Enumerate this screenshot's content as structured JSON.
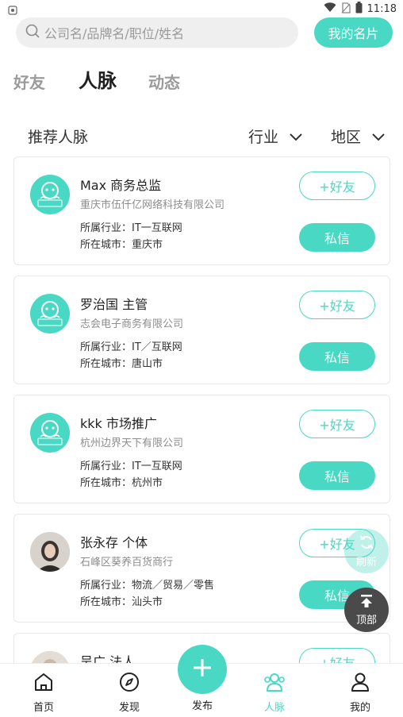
{
  "status": {
    "time": "11:18"
  },
  "search": {
    "placeholder": "公司名/品牌名/职位/姓名",
    "my_card_label": "我的名片"
  },
  "tabs": [
    {
      "label": "好友"
    },
    {
      "label": "人脉"
    },
    {
      "label": "动态"
    }
  ],
  "filters": {
    "title": "推荐人脉",
    "industry_label": "行业",
    "region_label": "地区"
  },
  "contacts": [
    {
      "name": "Max 商务总监",
      "company": "重庆市伍仟亿网络科技有限公司",
      "industry": "所属行业：IT一互联网",
      "city": "所在城市：重庆市",
      "add_label": "+好友",
      "msg_label": "私信",
      "avatar_text": "职场联盟"
    },
    {
      "name": "罗治国 主管",
      "company": "志会电子商务有限公司",
      "industry": "所属行业：IT／互联网",
      "city": "所在城市：唐山市",
      "add_label": "+好友",
      "msg_label": "私信",
      "avatar_text": "职场联盟"
    },
    {
      "name": "kkk 市场推广",
      "company": "杭州边界天下有限公司",
      "industry": "所属行业：IT一互联网",
      "city": "所在城市：杭州市",
      "add_label": "+好友",
      "msg_label": "私信",
      "avatar_text": "职场联盟"
    },
    {
      "name": "张永存 个体",
      "company": "石峰区葵养百货商行",
      "industry": "所属行业：物流／贸易／零售",
      "city": "所在城市：汕头市",
      "add_label": "+好友",
      "msg_label": "私信"
    },
    {
      "name": "吴广 法人",
      "company": "",
      "industry": "",
      "city": "",
      "add_label": "+好友",
      "msg_label": ""
    }
  ],
  "floating": {
    "refresh_label": "刷新",
    "top_label": "顶部"
  },
  "nav": [
    {
      "label": "首页"
    },
    {
      "label": "发现"
    },
    {
      "label": "发布"
    },
    {
      "label": "人脉"
    },
    {
      "label": "我的"
    }
  ],
  "colors": {
    "accent": "#48d8c4",
    "inactive_tab": "#9b9b9b",
    "dark_button": "#4a4a4a"
  }
}
